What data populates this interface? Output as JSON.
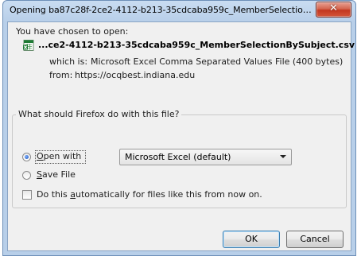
{
  "window": {
    "title": "Opening ba87c28f-2ce2-4112-b213-35cdcaba959c_MemberSelectionB...",
    "close_glyph": "✕"
  },
  "intro": {
    "chosen_label": "You have chosen to open:",
    "filename": "...ce2-4112-b213-35cdcaba959c_MemberSelectionBySubject.csv",
    "file_icon": "excel-csv-file-icon",
    "which_is_label": "which is:",
    "which_is_value": "Microsoft Excel Comma Separated Values File (400 bytes)",
    "from_label": "from:",
    "from_value": "https://ocqbest.indiana.edu"
  },
  "action_group": {
    "legend": "What should Firefox do with this file?",
    "open_with": {
      "mnemonic": "O",
      "rest": "pen with",
      "checked": true
    },
    "open_with_select": {
      "selected": "Microsoft Excel (default)"
    },
    "save_file": {
      "mnemonic": "S",
      "rest": "ave File",
      "checked": false
    },
    "auto": {
      "before": "Do this ",
      "mnemonic": "a",
      "after": "utomatically for files like this from now on.",
      "checked": false
    }
  },
  "buttons": {
    "ok": "OK",
    "cancel": "Cancel"
  },
  "colors": {
    "title_bar": "#c9dcf1",
    "close_button": "#c2361f",
    "dialog_bg": "#f0f0f0",
    "excel_green": "#1e7b34"
  }
}
